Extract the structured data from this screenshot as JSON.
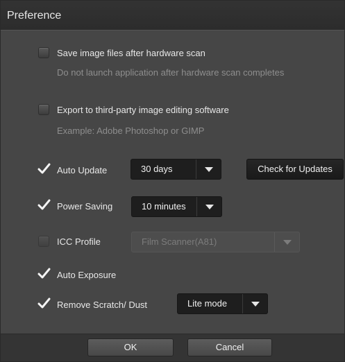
{
  "window": {
    "title": "Preference"
  },
  "options": {
    "save_after_scan": {
      "label": "Save image files after hardware scan",
      "description": "Do not launch application after hardware scan completes",
      "checked": false
    },
    "export_third_party": {
      "label": "Export to third-party image editing software",
      "description": "Example: Adobe Photoshop or GIMP",
      "checked": false
    },
    "auto_update": {
      "label": "Auto Update",
      "checked": true,
      "interval": "30 days",
      "check_button": "Check for Updates"
    },
    "power_saving": {
      "label": "Power Saving",
      "checked": true,
      "interval": "10 minutes"
    },
    "icc_profile": {
      "label": "ICC Profile",
      "checked": false,
      "profile": "Film Scanner(A81)"
    },
    "auto_exposure": {
      "label": "Auto Exposure",
      "checked": true
    },
    "remove_scratch": {
      "label": "Remove Scratch/ Dust",
      "checked": true,
      "mode": "Lite mode"
    }
  },
  "footer": {
    "ok": "OK",
    "cancel": "Cancel"
  },
  "icons": {
    "checkmark": "checkmark-icon",
    "dropdown": "chevron-down-icon"
  },
  "colors": {
    "panel": "#464646",
    "titlebar": "#2e2e2e",
    "dropdown_bg": "#1e1e1e",
    "text": "#e8e8e8",
    "muted_text": "#8e8e8e"
  }
}
